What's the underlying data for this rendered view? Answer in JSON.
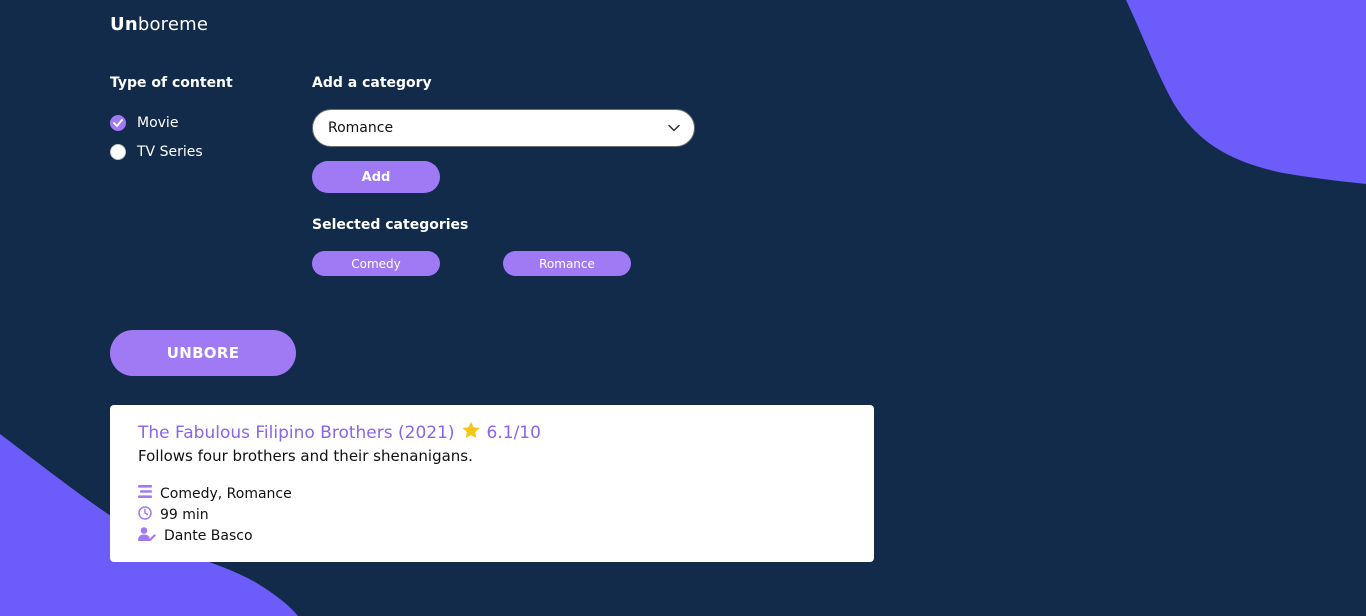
{
  "header": {
    "logo_bold": "Un",
    "logo_rest": "boreme"
  },
  "content_type": {
    "label": "Type of content",
    "options": [
      {
        "label": "Movie",
        "checked": true
      },
      {
        "label": "TV Series",
        "checked": false
      }
    ]
  },
  "category": {
    "label": "Add a category",
    "selected_value": "Romance",
    "add_label": "Add"
  },
  "selected_categories": {
    "label": "Selected categories",
    "items": [
      "Comedy",
      "Romance"
    ]
  },
  "unbore_button": "UNBORE",
  "result": {
    "title": "The Fabulous Filipino Brothers (2021)",
    "rating": "6.1/10",
    "rating_icon": "star-icon",
    "description": "Follows four brothers and their shenanigans.",
    "genres": "Comedy, Romance",
    "duration": "99 min",
    "director": "Dante Basco"
  },
  "colors": {
    "background": "#122b4a",
    "accent": "#a07af5",
    "blob": "#6c5dfb",
    "title_link": "#8a63ee",
    "star": "#f5c518"
  }
}
